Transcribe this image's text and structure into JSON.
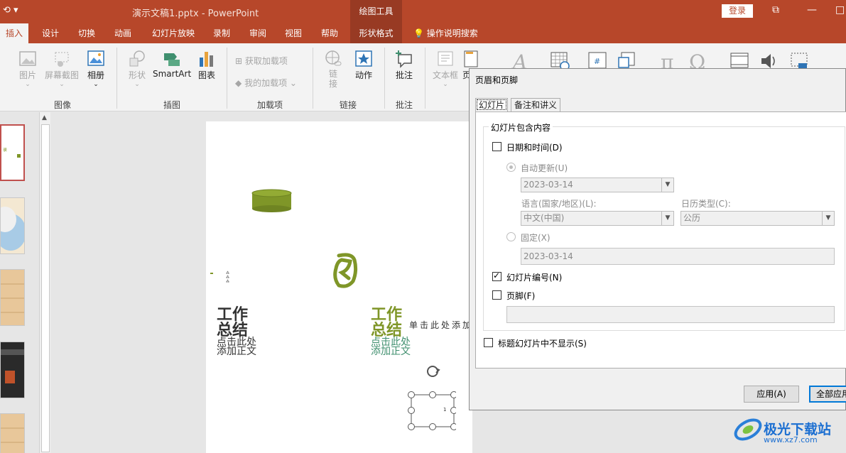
{
  "titlebar": {
    "doc_title": "演示文稿1.pptx  -  PowerPoint",
    "context_header": "绘图工具",
    "login": "登录"
  },
  "tabs": [
    {
      "label": "插入"
    },
    {
      "label": "设计"
    },
    {
      "label": "切换"
    },
    {
      "label": "动画"
    },
    {
      "label": "幻灯片放映"
    },
    {
      "label": "录制"
    },
    {
      "label": "审阅"
    },
    {
      "label": "视图"
    },
    {
      "label": "帮助"
    },
    {
      "label": "形状格式"
    }
  ],
  "tell_me": "操作说明搜索",
  "ribbon": {
    "image_group": {
      "label": "图像",
      "pictures": "图片",
      "screenshot": "屏幕截图",
      "album": "相册"
    },
    "illus_group": {
      "label": "插图",
      "shapes": "形状",
      "smartart": "SmartArt",
      "chart": "图表"
    },
    "addin_group": {
      "label": "加载项",
      "get": "获取加载项",
      "my": "我的加载项"
    },
    "link_group": {
      "label": "链接",
      "link": "链接",
      "action": "动作"
    },
    "comment_group": {
      "label": "批注",
      "comment": "批注"
    },
    "textbox": "文本框",
    "cut_label": "页"
  },
  "slide": {
    "title_left_1": "工作",
    "title_left_2": "总结",
    "sub_left_1": "点击此处",
    "sub_left_2": "添加正文",
    "title_right_1": "工作",
    "title_right_2": "总结",
    "sub_right_1": "点击此处",
    "sub_right_2": "添加正文",
    "side_text": "单击此处添加",
    "small_note": "1"
  },
  "dialog": {
    "title": "页眉和页脚",
    "tab_slide": "幻灯片",
    "tab_notes": "备注和讲义",
    "legend": "幻灯片包含内容",
    "date_time": "日期和时间(D)",
    "auto_update": "自动更新(U)",
    "auto_date_value": "2023-03-14",
    "language_label": "语言(国家/地区)(L):",
    "language_value": "中文(中国)",
    "calendar_label": "日历类型(C):",
    "calendar_value": "公历",
    "fixed": "固定(X)",
    "fixed_value": "2023-03-14",
    "slide_number": "幻灯片编号(N)",
    "footer": "页脚(F)",
    "footer_value": "",
    "hide_title": "标题幻灯片中不显示(S)",
    "apply": "应用(A)",
    "apply_all": "全部应用"
  },
  "state": {
    "date_time_checked": false,
    "slide_number_checked": true,
    "footer_checked": false,
    "hide_title_checked": false
  },
  "watermark": {
    "text": "极光下载站",
    "url": "www.xz7.com"
  },
  "colors": {
    "accent": "#b7472a",
    "context": "#983a23",
    "olive": "#7f9628",
    "teal": "#3f8f6e"
  }
}
